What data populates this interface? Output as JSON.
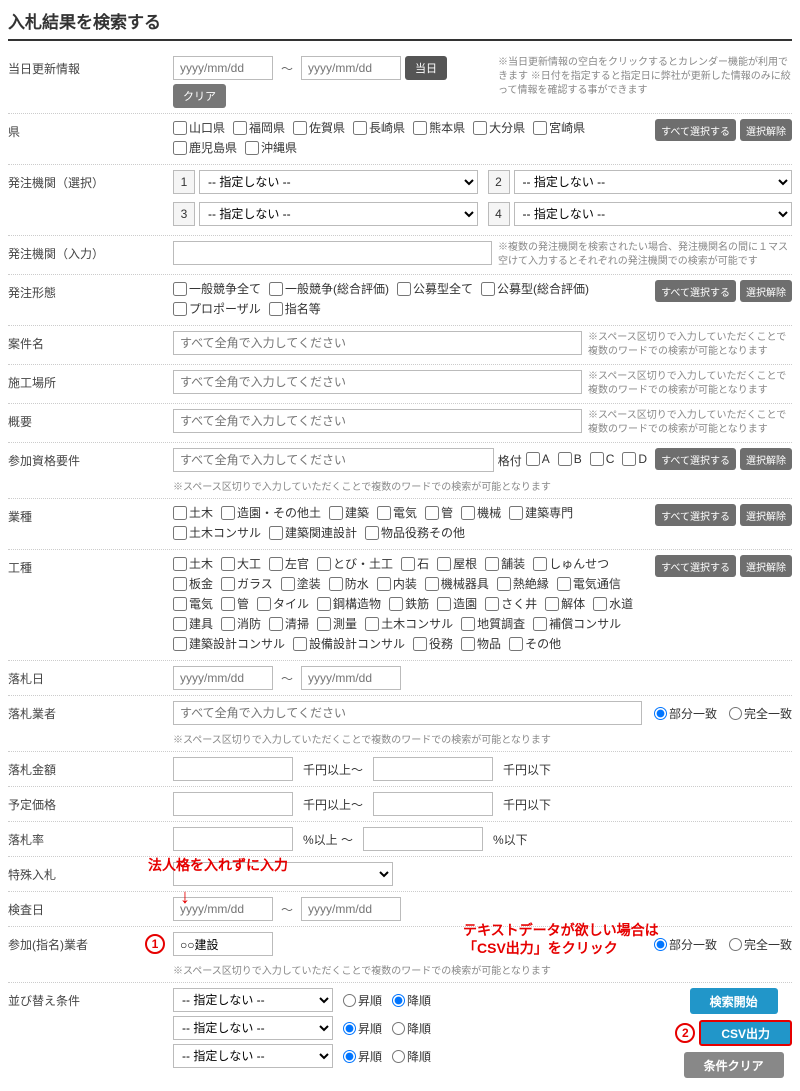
{
  "title": "入札結果を検索する",
  "rows": {
    "updateDate": {
      "label": "当日更新情報",
      "ph": "yyyy/mm/dd",
      "btn1": "当日",
      "btn2": "クリア",
      "note": "※当日更新情報の空白をクリックするとカレンダー機能が利用できます\n※日付を指定すると指定日に弊社が更新した情報のみに絞って情報を確認する事ができます"
    },
    "pref": {
      "label": "県",
      "items": [
        "山口県",
        "福岡県",
        "佐賀県",
        "長崎県",
        "熊本県",
        "大分県",
        "宮崎県",
        "鹿児島県",
        "沖縄県"
      ],
      "selAll": "すべて選択する",
      "clear": "選択解除"
    },
    "orgSel": {
      "label": "発注機関（選択）",
      "opt": "-- 指定しない --"
    },
    "orgInput": {
      "label": "発注機関（入力）",
      "note": "※複数の発注機関を検索されたい場合、発注機関名の間に１マス空けて入力するとそれぞれの発注機関での検索が可能です"
    },
    "bidType": {
      "label": "発注形態",
      "items": [
        "一般競争全て",
        "一般競争(総合評価)",
        "公募型全て",
        "公募型(総合評価)",
        "プロポーザル",
        "指名等"
      ],
      "selAll": "すべて選択する",
      "clear": "選択解除"
    },
    "projName": {
      "label": "案件名",
      "ph": "すべて全角で入力してください",
      "note": "※スペース区切りで入力していただくことで複数のワードでの検索が可能となります"
    },
    "place": {
      "label": "施工場所",
      "ph": "すべて全角で入力してください",
      "note": "※スペース区切りで入力していただくことで複数のワードでの検索が可能となります"
    },
    "summary": {
      "label": "概要",
      "ph": "すべて全角で入力してください",
      "note": "※スペース区切りで入力していただくことで複数のワードでの検索が可能となります"
    },
    "qual": {
      "label": "参加資格要件",
      "ph": "すべて全角で入力してください",
      "kakuzuke": "格付",
      "ranks": [
        "A",
        "B",
        "C",
        "D"
      ],
      "selAll": "すべて選択する",
      "clear": "選択解除",
      "subnote": "※スペース区切りで入力していただくことで複数のワードでの検索が可能となります"
    },
    "industry": {
      "label": "業種",
      "items": [
        "土木",
        "造園・その他土",
        "建築",
        "電気",
        "管",
        "機械",
        "建築専門",
        "土木コンサル",
        "建築関連設計",
        "物品役務その他"
      ],
      "selAll": "すべて選択する",
      "clear": "選択解除"
    },
    "workType": {
      "label": "工種",
      "items": [
        "土木",
        "大工",
        "左官",
        "とび・土工",
        "石",
        "屋根",
        "舗装",
        "しゅんせつ",
        "板金",
        "ガラス",
        "塗装",
        "防水",
        "内装",
        "機械器具",
        "熱絶縁",
        "電気通信",
        "電気",
        "管",
        "タイル",
        "鋼構造物",
        "鉄筋",
        "造園",
        "さく井",
        "解体",
        "水道",
        "建具",
        "消防",
        "清掃",
        "測量",
        "土木コンサル",
        "地質調査",
        "補償コンサル",
        "建築設計コンサル",
        "設備設計コンサル",
        "役務",
        "物品",
        "その他"
      ],
      "selAll": "すべて選択する",
      "clear": "選択解除"
    },
    "awardDate": {
      "label": "落札日",
      "ph": "yyyy/mm/dd"
    },
    "awardee": {
      "label": "落札業者",
      "ph": "すべて全角で入力してください",
      "r1": "部分一致",
      "r2": "完全一致",
      "subnote": "※スペース区切りで入力していただくことで複数のワードでの検索が可能となります"
    },
    "amount": {
      "label": "落札金額",
      "u1": "千円以上～",
      "u2": "千円以下"
    },
    "yotei": {
      "label": "予定価格",
      "u1": "千円以上～",
      "u2": "千円以下"
    },
    "rate": {
      "label": "落札率",
      "u1": "%以上  ～",
      "u2": "%以下"
    },
    "special": {
      "label": "特殊入札"
    },
    "inspect": {
      "label": "検査日",
      "ph": "yyyy/mm/dd"
    },
    "nominee": {
      "label": "参加(指名)業者",
      "val": "○○建設",
      "r1": "部分一致",
      "r2": "完全一致",
      "subnote": "※スペース区切りで入力していただくことで複数のワードでの検索が可能となります"
    },
    "sort": {
      "label": "並び替え条件",
      "opt": "-- 指定しない --",
      "asc": "昇順",
      "desc": "降順"
    }
  },
  "actions": {
    "search": "検索開始",
    "csv": "CSV出力",
    "clear": "条件クリア"
  },
  "annots": {
    "a1": "法人格を入れずに入力",
    "a2a": "テキストデータが欲しい場合は",
    "a2b": "「CSV出力」をクリック",
    "n1": "1",
    "n2": "2"
  }
}
